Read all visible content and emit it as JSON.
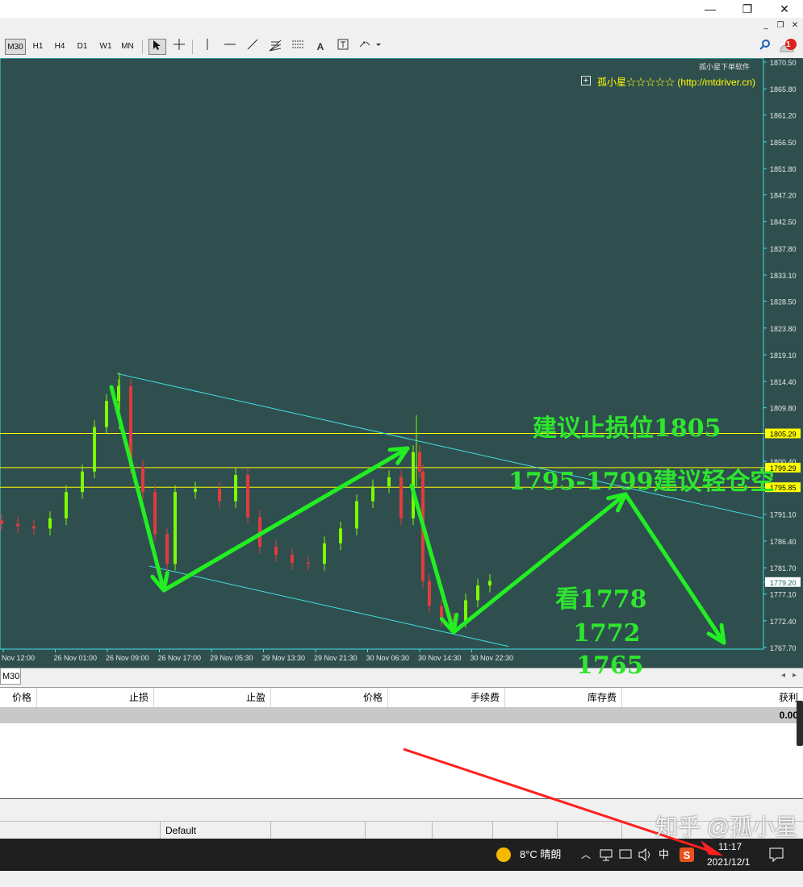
{
  "window": {
    "minimize": "—",
    "restore": "❐",
    "close": "✕"
  },
  "mdi": {
    "minimize": "_",
    "restore": "❐",
    "close": "✕"
  },
  "toolbar": {
    "timeframes": [
      "M30",
      "H1",
      "H4",
      "D1",
      "W1",
      "MN"
    ],
    "active_timeframe": "M30",
    "notification_count": "1"
  },
  "chart": {
    "watermark_small": "孤小星下单软件",
    "watermark_main": "孤小星☆☆☆☆☆ (http://mtdriver.cn)",
    "price_ticks": [
      "1870.50",
      "1865.80",
      "1861.20",
      "1856.50",
      "1851.80",
      "1847.20",
      "1842.50",
      "1837.80",
      "1833.10",
      "1828.50",
      "1823.80",
      "1819.10",
      "1814.40",
      "1809.80",
      "1805.29",
      "1800.40",
      "1799.29",
      "1795.85",
      "1791.10",
      "1786.40",
      "1781.70",
      "1779.20",
      "1777.10",
      "1772.40",
      "1767.70"
    ],
    "time_ticks": [
      "Nov 12:00",
      "26 Nov 01:00",
      "26 Nov 09:00",
      "26 Nov 17:00",
      "29 Nov 05:30",
      "29 Nov 13:30",
      "29 Nov 21:30",
      "30 Nov 06:30",
      "30 Nov 14:30",
      "30 Nov 22:30"
    ],
    "hlines": [
      1805.29,
      1799.29,
      1795.85
    ],
    "current_price": 1779.2,
    "annotations": {
      "stop_loss": "建议止损位1805",
      "short_zone": "1795-1799建议轻仓空",
      "target1": "看1778",
      "target2": "1772",
      "target3": "1765"
    },
    "colors": {
      "bg": "#2f4f4f",
      "bull": "#7cfc00",
      "bear": "#e23b3b",
      "level": "#ffff00",
      "channel": "#40e0e0",
      "arrow": "#22ee22",
      "axis": "#40e0e0"
    }
  },
  "tabrow": {
    "tab_label": "M30"
  },
  "terminal": {
    "columns": [
      "价格",
      "止损",
      "止盈",
      "价格",
      "手续费",
      "库存费",
      "获利"
    ],
    "profit_total": "0.00"
  },
  "statusbar": {
    "profile": "Default"
  },
  "taskbar": {
    "weather": "8°C  晴朗",
    "ime": "中",
    "time": "11:17",
    "date": "2021/12/1"
  },
  "overlay": {
    "watermark": "知乎 @孤小星"
  }
}
